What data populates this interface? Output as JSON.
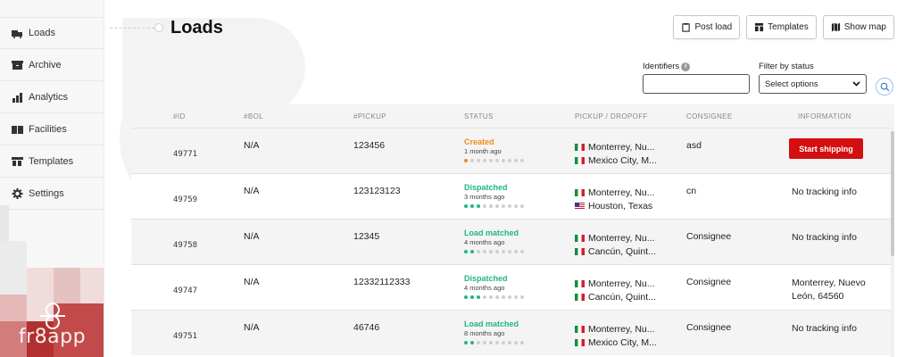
{
  "sidebar": {
    "items": [
      {
        "label": "Loads",
        "icon": "truck-icon"
      },
      {
        "label": "Archive",
        "icon": "archive-icon"
      },
      {
        "label": "Analytics",
        "icon": "bar-chart-icon"
      },
      {
        "label": "Facilities",
        "icon": "warehouse-icon"
      },
      {
        "label": "Templates",
        "icon": "template-icon"
      },
      {
        "label": "Settings",
        "icon": "gear-icon"
      }
    ],
    "brand": "fr8app"
  },
  "header": {
    "title": "Loads",
    "buttons": {
      "post_load": "Post load",
      "templates": "Templates",
      "show_map": "Show map"
    }
  },
  "filters": {
    "identifiers_label": "Identifiers",
    "info_glyph": "i",
    "status_label": "Filter by status",
    "status_value": "Select options"
  },
  "table": {
    "headers": {
      "id": "#ID",
      "bol": "#BOL",
      "pickup": "#PICKUP",
      "status": "STATUS",
      "route": "PICKUP / DROPOFF",
      "consignee": "CONSIGNEE",
      "information": "INFORMATION"
    },
    "rows": [
      {
        "id": "49771",
        "bol": "N/A",
        "pickup": "123456",
        "status": "Created",
        "status_color": "#f08c1a",
        "time": "1 month ago",
        "progress": 1,
        "pickup_place": "Monterrey, Nu...",
        "pickup_flag": "mx",
        "dropoff_place": "Mexico City, M...",
        "dropoff_flag": "mx",
        "consignee": "asd",
        "info": "",
        "action": "Start shipping"
      },
      {
        "id": "49759",
        "bol": "N/A",
        "pickup": "123123123",
        "status": "Dispatched",
        "status_color": "#1fb87a",
        "time": "3 months ago",
        "progress": 3,
        "pickup_place": "Monterrey, Nu...",
        "pickup_flag": "mx",
        "dropoff_place": "Houston, Texas",
        "dropoff_flag": "us",
        "consignee": "cn",
        "info": "No tracking info",
        "action": ""
      },
      {
        "id": "49758",
        "bol": "N/A",
        "pickup": "12345",
        "status": "Load matched",
        "status_color": "#1fb87a",
        "time": "4 months ago",
        "progress": 2,
        "pickup_place": "Monterrey, Nu...",
        "pickup_flag": "mx",
        "dropoff_place": "Cancún, Quint...",
        "dropoff_flag": "mx",
        "consignee": "Consignee",
        "info": "No tracking info",
        "action": ""
      },
      {
        "id": "49747",
        "bol": "N/A",
        "pickup": "12332112333",
        "status": "Dispatched",
        "status_color": "#1fb87a",
        "time": "4 months ago",
        "progress": 3,
        "pickup_place": "Monterrey, Nu...",
        "pickup_flag": "mx",
        "dropoff_place": "Cancún, Quint...",
        "dropoff_flag": "mx",
        "consignee": "Consignee",
        "info": "Monterrey, Nuevo León, 64560",
        "action": ""
      },
      {
        "id": "49751",
        "bol": "N/A",
        "pickup": "46746",
        "status": "Load matched",
        "status_color": "#1fb87a",
        "time": "8 months ago",
        "progress": 2,
        "pickup_place": "Monterrey, Nu...",
        "pickup_flag": "mx",
        "dropoff_place": "Mexico City, M...",
        "dropoff_flag": "mx",
        "consignee": "Consignee",
        "info": "No tracking info",
        "action": ""
      }
    ],
    "progress_steps": 10
  },
  "colors": {
    "accent_red": "#d30f0f",
    "created": "#f08c1a",
    "success": "#1fb87a"
  }
}
